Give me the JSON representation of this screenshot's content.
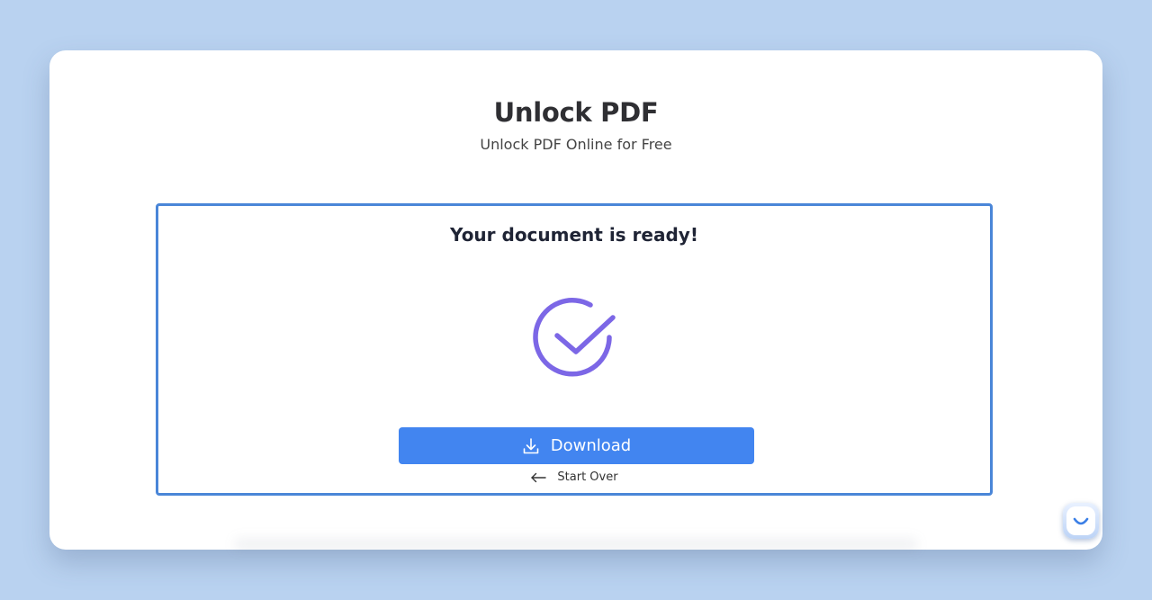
{
  "header": {
    "title": "Unlock PDF",
    "subtitle": "Unlock PDF Online for Free"
  },
  "result": {
    "heading": "Your document is ready!",
    "status_icon": "check-circle-icon",
    "download_label": "Download",
    "download_icon": "download-icon",
    "start_over_label": "Start Over",
    "start_over_icon": "arrow-left-icon"
  },
  "chat_widget": {
    "icon": "smile-chat-icon"
  },
  "colors": {
    "page_background": "#b9d2f0",
    "box_border": "#4a86d8",
    "accent_button": "#4285f0",
    "check_icon": "#7c67e6"
  }
}
